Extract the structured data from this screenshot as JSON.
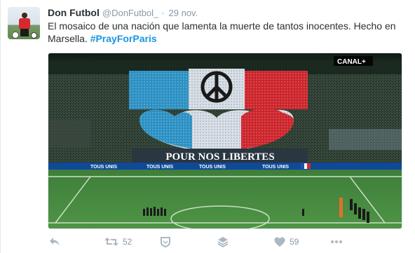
{
  "tweet": {
    "name": "Don Futbol",
    "handle": "@DonFutbol_",
    "separator": "·",
    "time": "29 nov.",
    "text": "El mosaico de una nación que lamenta la muerte de tantos inocentes. Hecho en Marsella.",
    "hashtag": "#PrayForParis"
  },
  "media": {
    "watermark": "CANAL+",
    "banner": "POUR NOS LIBERTES",
    "ad_text": "TOUS UNIS"
  },
  "actions": {
    "retweet_count": "52",
    "like_count": "59"
  },
  "colors": {
    "link": "#1b95e0",
    "icon": "#aab8c2",
    "text": "#292f33",
    "muted": "#8899a6"
  }
}
